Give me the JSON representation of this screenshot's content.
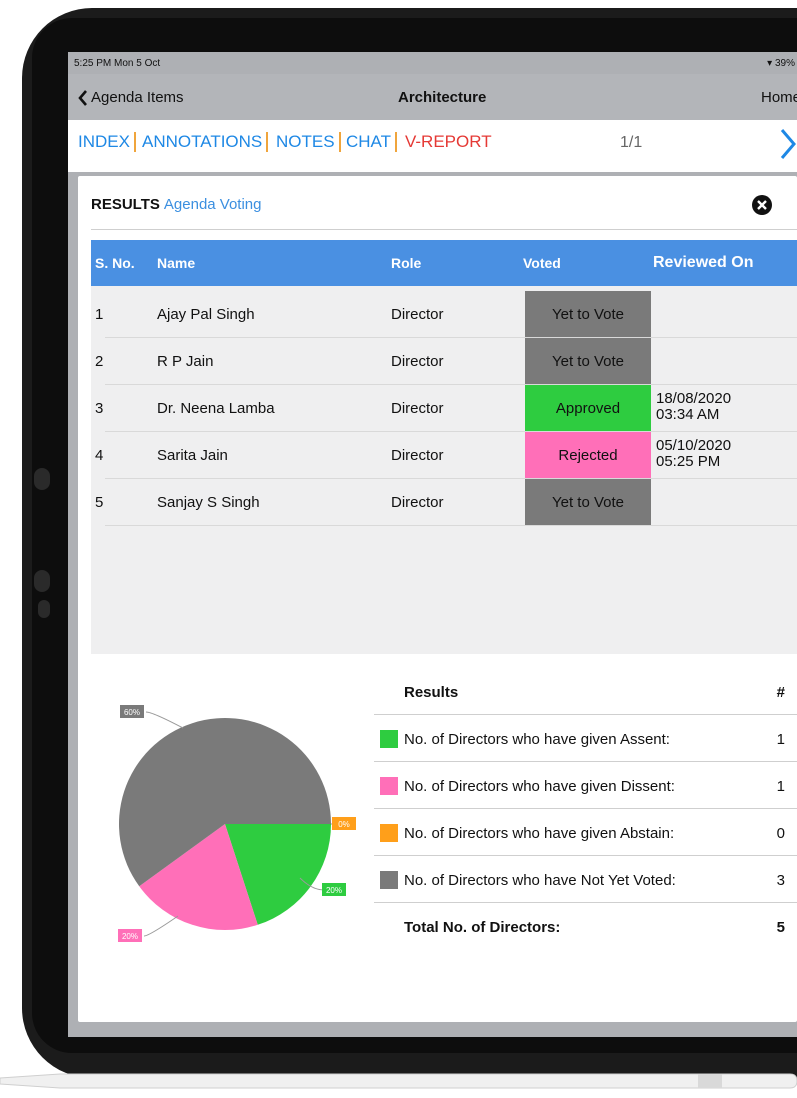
{
  "status": {
    "time": "5:25 PM  Mon 5 Oct",
    "battery": "39%"
  },
  "nav": {
    "back_label": "Agenda Items",
    "title": "Architecture",
    "home_label": "Home"
  },
  "tabs": [
    {
      "label": "INDEX"
    },
    {
      "label": "ANNOTATIONS"
    },
    {
      "label": "NOTES"
    },
    {
      "label": "CHAT"
    },
    {
      "label": "V-REPORT"
    }
  ],
  "pager": "1/1",
  "modal": {
    "title_bold": "RESULTS",
    "title_sub": "Agenda Voting"
  },
  "table": {
    "headers": [
      "S. No.",
      "Name",
      "Role",
      "Voted",
      "Reviewed On"
    ],
    "rows": [
      {
        "sno": "1",
        "name": "Ajay Pal Singh",
        "role": "Director",
        "voted": "Yet to Vote",
        "rev_date": "",
        "rev_time": ""
      },
      {
        "sno": "2",
        "name": "R P Jain",
        "role": "Director",
        "voted": "Yet to Vote",
        "rev_date": "",
        "rev_time": ""
      },
      {
        "sno": "3",
        "name": "Dr. Neena Lamba",
        "role": "Director",
        "voted": "Approved",
        "rev_date": "18/08/2020",
        "rev_time": "03:34 AM"
      },
      {
        "sno": "4",
        "name": "Sarita Jain",
        "role": "Director",
        "voted": "Rejected",
        "rev_date": "05/10/2020",
        "rev_time": "05:25 PM"
      },
      {
        "sno": "5",
        "name": "Sanjay S Singh",
        "role": "Director",
        "voted": "Yet to Vote",
        "rev_date": "",
        "rev_time": ""
      }
    ]
  },
  "colors": {
    "yet": "#7a7a7a",
    "approved": "#2ecc40",
    "rejected": "#ff6fb8",
    "abstain": "#ff9f1a",
    "header": "#4a90e2",
    "accent": "#1e88e5",
    "active_tab": "#e53935"
  },
  "results": {
    "header": "Results",
    "count_header": "#",
    "rows": [
      {
        "label": "No. of Directors who have given Assent:",
        "count": "1"
      },
      {
        "label": "No. of Directors who have given Dissent:",
        "count": "1"
      },
      {
        "label": "No. of Directors who have given Abstain:",
        "count": "0"
      },
      {
        "label": "No. of Directors who have Not Yet Voted:",
        "count": "3"
      }
    ],
    "total_label": "Total No. of Directors:",
    "total": "5"
  },
  "chart_data": {
    "type": "pie",
    "labels": [
      "Assent",
      "Dissent",
      "Abstain",
      "Not Yet Voted"
    ],
    "values": [
      20,
      20,
      0,
      60
    ],
    "value_labels": [
      "20%",
      "20%",
      "0%",
      "60%"
    ],
    "colors": [
      "#2ecc40",
      "#ff6fb8",
      "#ff9f1a",
      "#7a7a7a"
    ]
  }
}
